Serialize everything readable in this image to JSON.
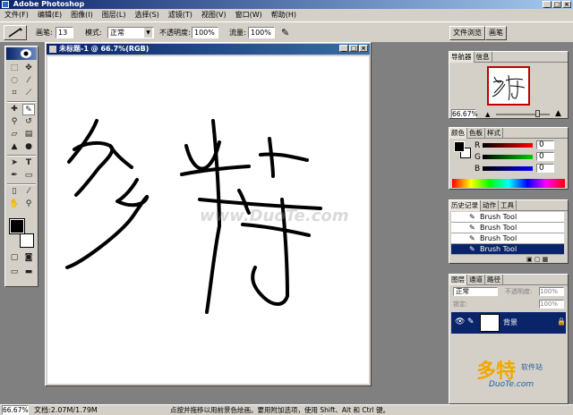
{
  "app": {
    "title": "Adobe Photoshop",
    "window_buttons": [
      "_",
      "□",
      "×"
    ]
  },
  "menu": [
    "文件(F)",
    "编辑(E)",
    "图像(I)",
    "图层(L)",
    "选择(S)",
    "滤镜(T)",
    "视图(V)",
    "窗口(W)",
    "帮助(H)"
  ],
  "options": {
    "brush_label": "画笔:",
    "brush_size": "13",
    "mode_label": "模式:",
    "mode_value": "正常",
    "opacity_label": "不透明度:",
    "opacity_value": "100%",
    "flow_label": "流量:",
    "flow_value": "100%"
  },
  "right_tabs": [
    "文件浏览",
    "画笔"
  ],
  "document": {
    "title": "未标题-1 @ 66.7%(RGB)",
    "handwriting": "多特"
  },
  "watermark": "www.DuoTe.com",
  "navigator": {
    "tabs": [
      "导航器",
      "信息"
    ],
    "zoom": "66.67%"
  },
  "color_panel": {
    "tabs": [
      "颜色",
      "色板",
      "样式"
    ],
    "channels": [
      {
        "label": "R",
        "value": "0",
        "color": "#ff0000"
      },
      {
        "label": "G",
        "value": "0",
        "color": "#00a000"
      },
      {
        "label": "B",
        "value": "0",
        "color": "#0000ff"
      }
    ]
  },
  "history_panel": {
    "tabs": [
      "历史记录",
      "动作",
      "工具"
    ],
    "items": [
      "Brush Tool",
      "Brush Tool",
      "Brush Tool",
      "Brush Tool"
    ],
    "selected_index": 3
  },
  "layers_panel": {
    "tabs": [
      "图层",
      "通道",
      "路径"
    ],
    "mode": "正常",
    "opacity_label": "不透明度:",
    "opacity_value": "100%",
    "lock_label": "锁定:",
    "fill_value": "100%",
    "layer_name": "背景"
  },
  "status": {
    "zoom": "66.67%",
    "doc_info": "文档:2.07M/1.79M",
    "hint": "点按并拖移以用前景色绘画。要用附加选项，使用 Shift、Alt 和 Ctrl 键。"
  },
  "logo": {
    "name": "多特",
    "sub": "软件站",
    "url": "DuoTe.com"
  },
  "colors": {
    "titlebar": "#0a246a",
    "history_selected": "#0a246a",
    "foreground": "#000000",
    "background": "#ffffff"
  }
}
